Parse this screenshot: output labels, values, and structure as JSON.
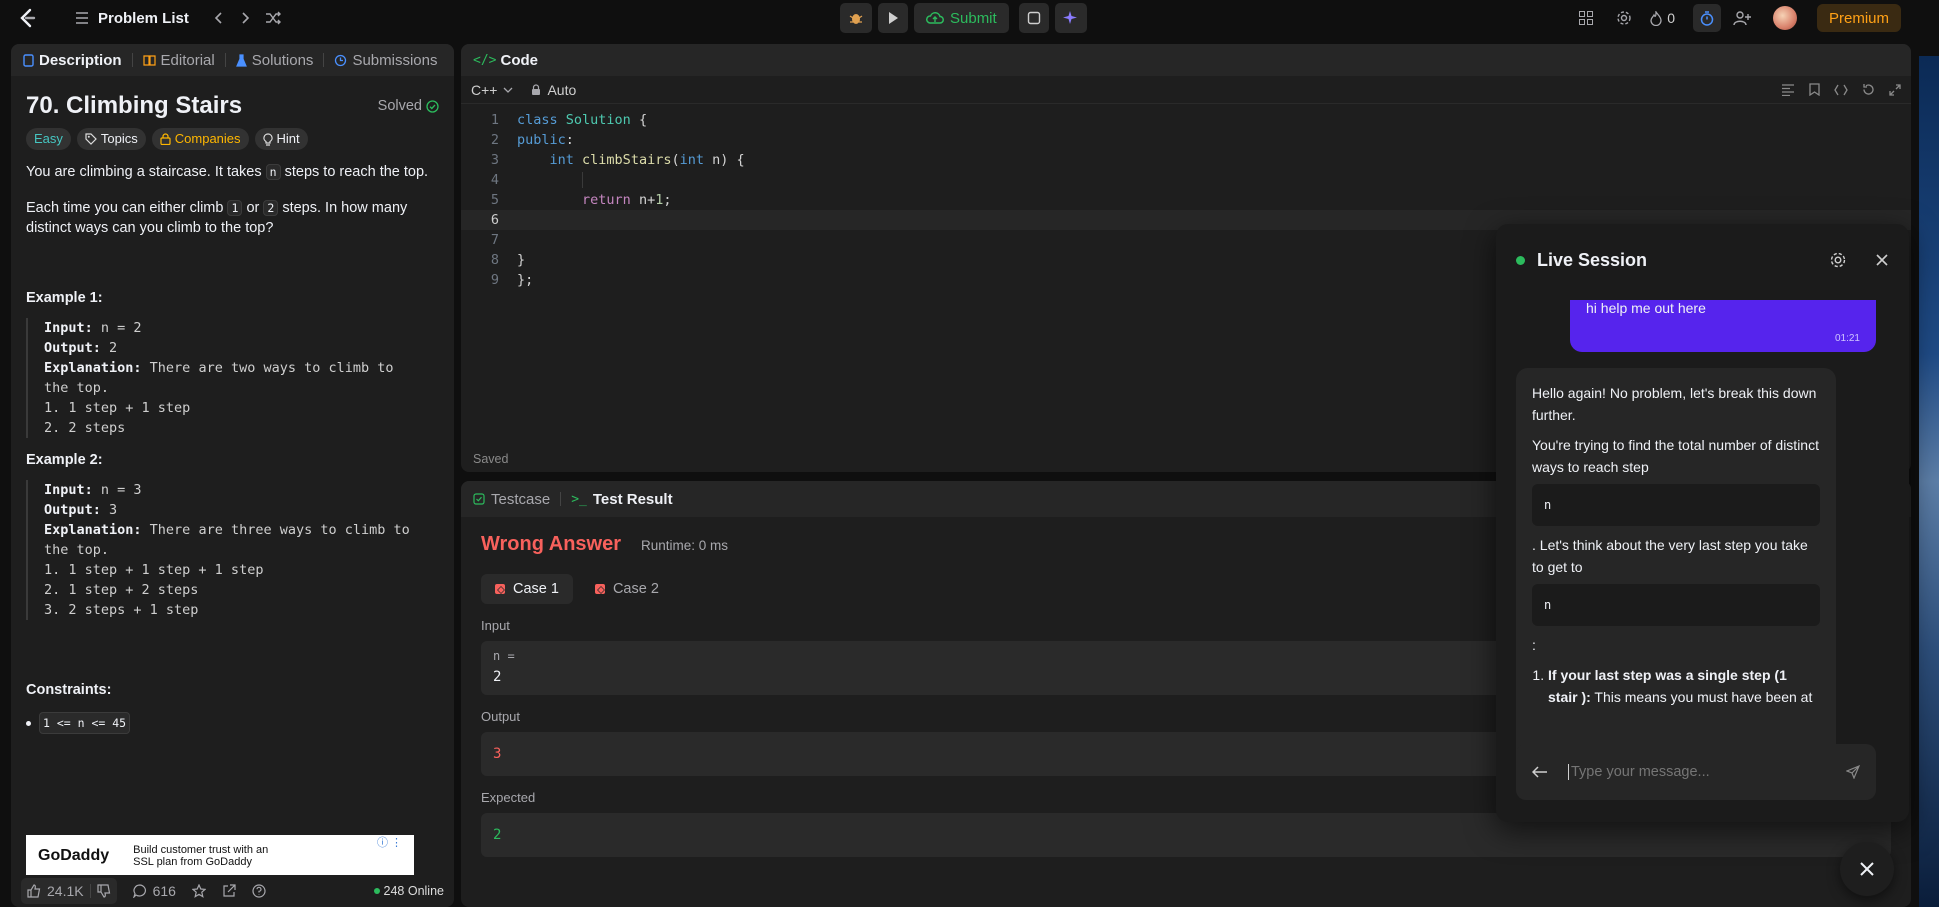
{
  "topbar": {
    "problem_list": "Problem List",
    "submit": "Submit",
    "streak": "0",
    "premium": "Premium"
  },
  "desc": {
    "tabs": [
      "Description",
      "Editorial",
      "Solutions",
      "Submissions"
    ],
    "title": "70. Climbing Stairs",
    "solved": "Solved",
    "tags": {
      "difficulty": "Easy",
      "topics": "Topics",
      "companies": "Companies",
      "hint": "Hint"
    },
    "p1_a": "You are climbing a staircase. It takes ",
    "p1_code": "n",
    "p1_b": " steps to reach the top.",
    "p2_a": "Each time you can either climb ",
    "p2_c1": "1",
    "p2_or": " or ",
    "p2_c2": "2",
    "p2_b": " steps. In how many distinct ways can you climb to the top?",
    "ex1_title": "Example 1:",
    "ex1": {
      "input_label": "Input:",
      "input": " n = 2",
      "output_label": "Output:",
      "output": " 2",
      "expl_label": "Explanation:",
      "expl": " There are two ways to climb to",
      "expl2": "the top.",
      "l1": "1. 1 step + 1 step",
      "l2": "2. 2 steps"
    },
    "ex2_title": "Example 2:",
    "ex2": {
      "input_label": "Input:",
      "input": " n = 3",
      "output_label": "Output:",
      "output": " 3",
      "expl_label": "Explanation:",
      "expl": " There are three ways to climb to",
      "expl2": "the top.",
      "l1": "1. 1 step + 1 step + 1 step",
      "l2": "2. 1 step + 2 steps",
      "l3": "3. 2 steps + 1 step"
    },
    "constraints_title": "Constraints:",
    "constraint": "1 <= n <= 45",
    "ad_brand": "GoDaddy",
    "ad_text": "Build customer trust with an SSL plan from GoDaddy",
    "likes": "24.1K",
    "comments": "616",
    "online": "248 Online"
  },
  "code": {
    "title": "Code",
    "language": "C++",
    "mode": "Auto",
    "saved": "Saved",
    "lines": [
      {
        "n": "1",
        "t": "class Solution {"
      },
      {
        "n": "2",
        "t": "public:"
      },
      {
        "n": "3",
        "t": "    int climbStairs(int n) {"
      },
      {
        "n": "4",
        "t": ""
      },
      {
        "n": "5",
        "t": "        return n+1;"
      },
      {
        "n": "6",
        "t": ""
      },
      {
        "n": "7",
        "t": ""
      },
      {
        "n": "8",
        "t": "}"
      },
      {
        "n": "9",
        "t": "};"
      }
    ]
  },
  "result": {
    "tab_testcase": "Testcase",
    "tab_result": "Test Result",
    "verdict": "Wrong Answer",
    "runtime": "Runtime: 0 ms",
    "case1": "Case 1",
    "case2": "Case 2",
    "input_label": "Input",
    "input_var": "n =",
    "input_val": "2",
    "output_label": "Output",
    "output_val": "3",
    "expected_label": "Expected",
    "expected_val": "2"
  },
  "live": {
    "title": "Live Session",
    "user_msg": "hi help me out here",
    "user_time": "01:21",
    "bot_p1": "Hello again! No problem, let's break this down further.",
    "bot_p2": "You're trying to find the total number of distinct ways to reach step",
    "bot_code1": "n",
    "bot_p3": ". Let's think about the very last step you take to get to",
    "bot_code2": "n",
    "bot_colon": ":",
    "bot_li_bold": "If your last step was a single step (1 stair ):",
    "bot_li_rest": " This means you must have been at",
    "placeholder": "Type your message..."
  },
  "colors": {
    "accent": "#ffa116",
    "success": "#2cbb5d",
    "error": "#f8615c",
    "chat": "#5624ed"
  }
}
